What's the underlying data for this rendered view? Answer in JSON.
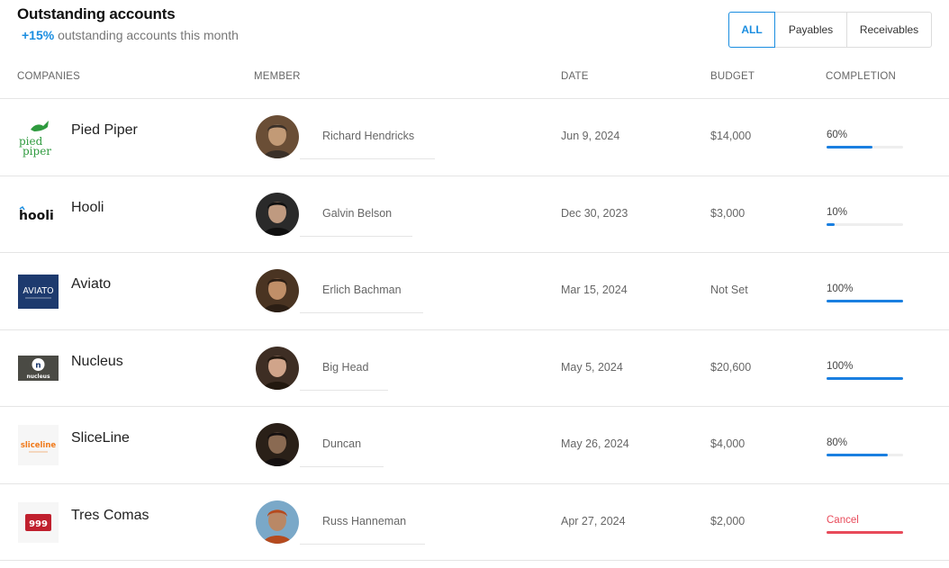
{
  "header": {
    "title": "Outstanding accounts",
    "subtitle_pct": "+15%",
    "subtitle_text": "outstanding accounts this month"
  },
  "filters": [
    {
      "label": "ALL",
      "active": true
    },
    {
      "label": "Payables",
      "active": false
    },
    {
      "label": "Receivables",
      "active": false
    }
  ],
  "columns": [
    "COMPANIES",
    "MEMBER",
    "DATE",
    "BUDGET",
    "COMPLETION"
  ],
  "colors": {
    "accent": "#1a8de0",
    "progress": "#1a7fe0",
    "cancel": "#e84a5a"
  },
  "rows": [
    {
      "company": "Pied Piper",
      "logo": "pied-piper-logo",
      "logo_text": "pied piper",
      "member": "Richard Hendricks",
      "date": "Jun 9, 2024",
      "budget": "$14,000",
      "completion": "60%",
      "progress": 0.6,
      "status": "progress"
    },
    {
      "company": "Hooli",
      "logo": "hooli-logo",
      "logo_text": "hooli",
      "member": "Galvin Belson",
      "date": "Dec 30, 2023",
      "budget": "$3,000",
      "completion": "10%",
      "progress": 0.1,
      "status": "progress"
    },
    {
      "company": "Aviato",
      "logo": "aviato-logo",
      "logo_text": "AVIATO",
      "member": "Erlich Bachman",
      "date": "Mar 15, 2024",
      "budget": "Not Set",
      "completion": "100%",
      "progress": 1.0,
      "status": "progress"
    },
    {
      "company": "Nucleus",
      "logo": "nucleus-logo",
      "logo_text": "nucleus",
      "member": "Big Head",
      "date": "May 5, 2024",
      "budget": "$20,600",
      "completion": "100%",
      "progress": 1.0,
      "status": "progress"
    },
    {
      "company": "SliceLine",
      "logo": "sliceline-logo",
      "logo_text": "sliceline",
      "member": "Duncan",
      "date": "May 26, 2024",
      "budget": "$4,000",
      "completion": "80%",
      "progress": 0.8,
      "status": "progress"
    },
    {
      "company": "Tres Comas",
      "logo": "tres-comas-logo",
      "logo_text": "999",
      "member": "Russ Hanneman",
      "date": "Apr 27, 2024",
      "budget": "$2,000",
      "completion": "Cancel",
      "progress": 1.0,
      "status": "cancel"
    }
  ]
}
